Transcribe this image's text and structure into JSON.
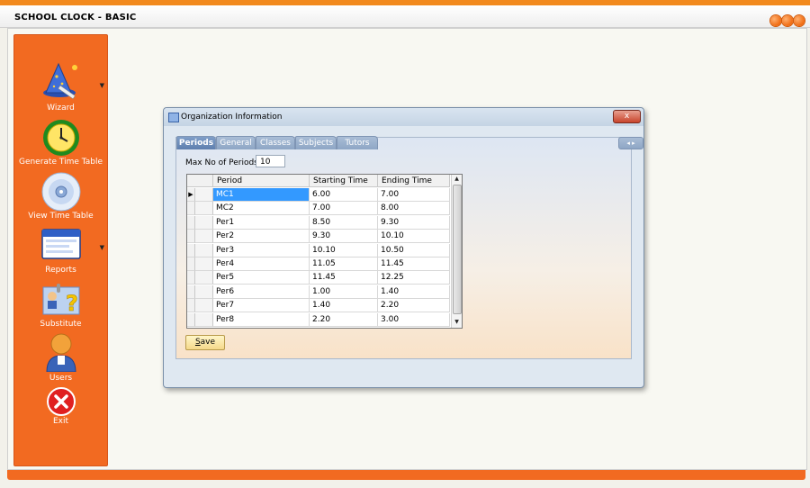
{
  "app": {
    "title": "SCHOOL CLOCK - BASIC"
  },
  "sidebar": {
    "items": [
      {
        "label": "Wizard",
        "icon": "wizard-hat-icon",
        "has_arrow": true
      },
      {
        "label": "Generate Time Table",
        "icon": "clock-icon"
      },
      {
        "label": "View Time Table",
        "icon": "cd-disc-icon"
      },
      {
        "label": "Reports",
        "icon": "window-report-icon",
        "has_arrow": true
      },
      {
        "label": "Substitute",
        "icon": "substitute-question-icon"
      },
      {
        "label": "Users",
        "icon": "user-icon"
      },
      {
        "label": "Exit",
        "icon": "close-x-icon"
      }
    ]
  },
  "dialog": {
    "title": "Organization Information",
    "close_label": "x",
    "tabs": [
      {
        "label": "Periods",
        "active": true
      },
      {
        "label": "General"
      },
      {
        "label": "Classes"
      },
      {
        "label": "Subjects"
      },
      {
        "label": "Tutors"
      }
    ],
    "max_periods_label": "Max No of Periods:",
    "max_periods_value": "10",
    "save_label": "Save",
    "save_mnemonic": "S",
    "save_rest": "ave",
    "grid": {
      "columns": [
        "Period",
        "Starting Time",
        "Ending Time"
      ],
      "current_row_marker": "▶",
      "rows": [
        {
          "period": "MC1",
          "start": "6.00",
          "end": "7.00"
        },
        {
          "period": "MC2",
          "start": "7.00",
          "end": "8.00"
        },
        {
          "period": "Per1",
          "start": "8.50",
          "end": "9.30"
        },
        {
          "period": "Per2",
          "start": "9.30",
          "end": "10.10"
        },
        {
          "period": "Per3",
          "start": "10.10",
          "end": "10.50"
        },
        {
          "period": "Per4",
          "start": "11.05",
          "end": "11.45"
        },
        {
          "period": "Per5",
          "start": "11.45",
          "end": "12.25"
        },
        {
          "period": "Per6",
          "start": "1.00",
          "end": "1.40"
        },
        {
          "period": "Per7",
          "start": "1.40",
          "end": "2.20"
        },
        {
          "period": "Per8",
          "start": "2.20",
          "end": "3.00"
        }
      ]
    }
  },
  "colors": {
    "accent": "#f26a21",
    "selected_cell": "#3399ff"
  }
}
